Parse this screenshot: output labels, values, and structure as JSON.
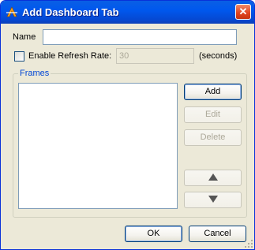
{
  "window": {
    "title": "Add Dashboard Tab",
    "close_glyph": "✕",
    "icon": "app-logo-icon"
  },
  "form": {
    "name_label": "Name",
    "name_value": "",
    "refresh_checkbox_label": "Enable Refresh Rate:",
    "refresh_checked": false,
    "refresh_value": "30",
    "refresh_unit": "(seconds)"
  },
  "frames": {
    "group_label": "Frames",
    "items": [],
    "add_label": "Add",
    "edit_label": "Edit",
    "delete_label": "Delete",
    "move_up_icon": "up-arrow-icon",
    "move_down_icon": "down-arrow-icon"
  },
  "footer": {
    "ok_label": "OK",
    "cancel_label": "Cancel"
  }
}
